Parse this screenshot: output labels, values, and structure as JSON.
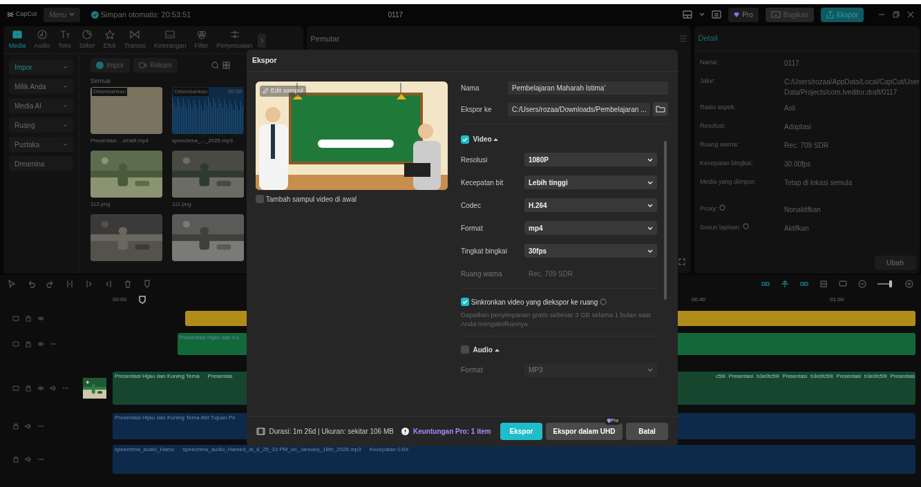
{
  "titlebar": {
    "logo": "CapCut",
    "menu": "Menu",
    "autosave": "Simpan otomatis: 20:53:51",
    "project": "0117",
    "pro": "Pro",
    "share": "Bagikan",
    "export": "Ekspor"
  },
  "tool_tabs": [
    {
      "label": "Media",
      "selected": true
    },
    {
      "label": "Audio",
      "selected": false
    },
    {
      "label": "Teks",
      "selected": false
    },
    {
      "label": "Stiker",
      "selected": false
    },
    {
      "label": "Efek",
      "selected": false
    },
    {
      "label": "Transisi",
      "selected": false
    },
    {
      "label": "Keterangan",
      "selected": false
    },
    {
      "label": "Filter",
      "selected": false
    },
    {
      "label": "Penyesuaian",
      "selected": false
    }
  ],
  "media_sidebar": [
    {
      "label": "Impor",
      "selected": true
    },
    {
      "label": "Milik Anda",
      "selected": false
    },
    {
      "label": "Media AI",
      "selected": false
    },
    {
      "label": "Ruang",
      "selected": false
    },
    {
      "label": "Pustaka",
      "selected": false
    },
    {
      "label": "Dreamina",
      "selected": false
    }
  ],
  "media_toolbar": {
    "import": "Impor",
    "record": "Rekam"
  },
  "media_filter": "Semua",
  "media_items": [
    {
      "kind": "video",
      "badge": "Ditambahkan",
      "name": "Presentasi ...stratif.mp4"
    },
    {
      "kind": "audio",
      "badge": "Ditambahkan",
      "duration": "00:39",
      "name": "speechma_..._2026.mp3"
    },
    {
      "kind": "picture",
      "name": "112.png"
    },
    {
      "kind": "picture",
      "name": "111.png"
    },
    {
      "kind": "picture"
    },
    {
      "kind": "picture"
    }
  ],
  "player": {
    "title": "Pemutar"
  },
  "detail": {
    "title": "Detail",
    "rows": [
      {
        "label": "Nama:",
        "value": "0117"
      },
      {
        "label": "Jalur:",
        "value": "C:/Users/rozaa/AppData/Local/CapCut/User Data/Projects/com.lveditor.draft/0117"
      },
      {
        "label": "Rasio aspek:",
        "value": "Asli"
      },
      {
        "label": "Resolusi:",
        "value": "Adaptasi"
      },
      {
        "label": "Ruang warna:",
        "value": "Rec. 709 SDR"
      },
      {
        "label": "Kecepatan bingkai:",
        "value": "30.00fps"
      },
      {
        "label": "Media yang diimpor:",
        "value": "Tetap di lokasi semula"
      },
      {
        "label": "Proxy:",
        "value": "Nonaktifkan",
        "info": true
      },
      {
        "label": "Susun lapisan:",
        "value": "Aktifkan",
        "info": true
      }
    ],
    "button": "Ubah"
  },
  "timeline": {
    "ruler": [
      "00:00",
      "00:40",
      "01:00"
    ],
    "zoom": {
      "level": 0.85
    },
    "tracks": [
      {
        "kind": "overlay"
      },
      {
        "kind": "text",
        "left": [
          "Presentasi Hijau dan Ku"
        ]
      },
      {
        "kind": "video",
        "left": [
          "Presentasi Hijau dan Kuning Tema",
          "Presentas"
        ],
        "right": [
          "c59i",
          "Presentasi",
          "b3e0fc59i",
          "Presentasi",
          "b3e0fc59i",
          "Presentasi",
          "b3e0fc59i",
          "Presentasi"
        ]
      },
      {
        "kind": "audio",
        "left": [
          "Presentasi Hijau dan Kuning Tema Abt Tujuan Pe"
        ]
      },
      {
        "kind": "voice",
        "left": [
          "speechma_audio_Hamc",
          "speechma_audio_Hamed_at_8_25_33 PM_on_January_18th_2026.mp3",
          "Kecepatan 0.6X"
        ]
      }
    ]
  },
  "export_dialog": {
    "title": "Ekspor",
    "cover_edit": "Edit sampul",
    "cover_option": {
      "label": "Tambah sampul video di awal",
      "checked": false
    },
    "name": {
      "label": "Nama",
      "value": "Pembelajaran Maharah Istima'"
    },
    "path": {
      "label": "Ekspor ke",
      "value": "C:/Users/rozaa/Downloads/Pembelajaran ..."
    },
    "video": {
      "label": "Video",
      "checked": true,
      "expanded": true,
      "settings": [
        {
          "kind": "select",
          "label": "Resolusi",
          "value": "1080P",
          "disabled": false
        },
        {
          "kind": "select",
          "label": "Kecepatan bit",
          "value": "Lebih tinggi",
          "disabled": false
        },
        {
          "kind": "select",
          "label": "Codec",
          "value": "H.264",
          "disabled": false
        },
        {
          "kind": "select",
          "label": "Format",
          "value": "mp4",
          "disabled": false
        },
        {
          "kind": "select",
          "label": "Tingkat bingkai",
          "value": "30fps",
          "disabled": false
        },
        {
          "kind": "static",
          "label": "Ruang warna",
          "value": "Rec. 709 SDR",
          "disabled": true
        }
      ]
    },
    "sync": {
      "label": "Sinkronkan video yang diekspor ke ruang",
      "checked": true,
      "note": "Dapatkan penyimpanan gratis sebesar 3 GB selama 1 bulan saat Anda mengaktifkannya."
    },
    "audio": {
      "label": "Audio",
      "checked": false,
      "expanded": true,
      "settings": [
        {
          "kind": "select",
          "label": "Format",
          "value": "MP3",
          "disabled": true
        }
      ]
    },
    "footer": {
      "info": "Durasi: 1m 26d | Ukuran: sekitar 106 MB",
      "pro_benefit": "Keuntungan Pro: 1 item",
      "buttons": [
        {
          "kind": "primary",
          "label": "Ekspor"
        },
        {
          "kind": "pro",
          "label": "Ekspor dalam UHD",
          "badge": "Pro"
        },
        {
          "kind": "secondary",
          "label": "Batal"
        }
      ]
    }
  }
}
